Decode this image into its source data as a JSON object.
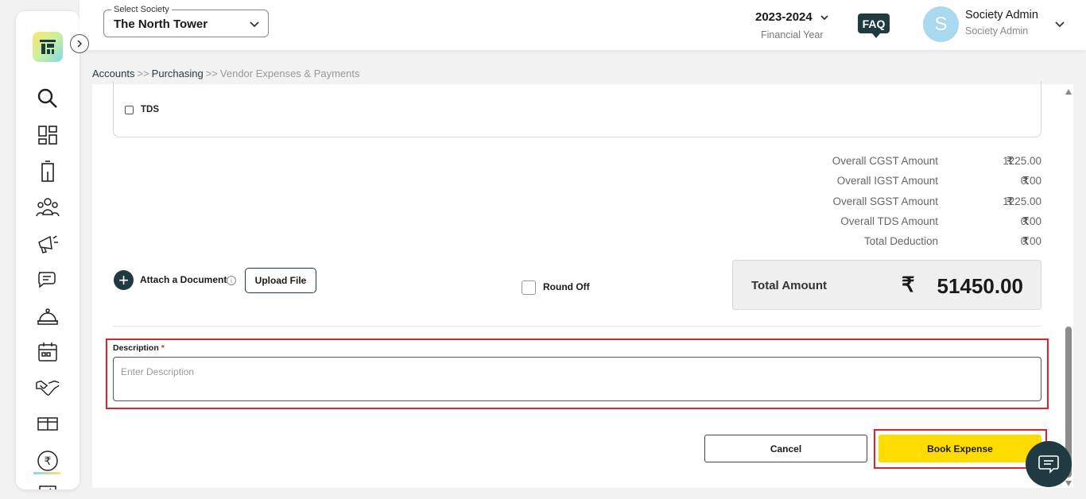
{
  "header": {
    "society_label": "Select Society",
    "society_value": "The North Tower",
    "financial_year": "2023-2024",
    "financial_year_label": "Financial Year",
    "faq_label": "FAQ",
    "avatar_initial": "S",
    "user_name": "Society Admin",
    "user_role": "Society Admin"
  },
  "sidebar": {
    "items": [
      {
        "icon": "search-icon"
      },
      {
        "icon": "dashboard-icon"
      },
      {
        "icon": "building-icon"
      },
      {
        "icon": "members-icon"
      },
      {
        "icon": "announcement-icon"
      },
      {
        "icon": "chat-icon"
      },
      {
        "icon": "service-icon"
      },
      {
        "icon": "calendar-icon"
      },
      {
        "icon": "handshake-icon"
      },
      {
        "icon": "parcel-icon"
      },
      {
        "icon": "rupee-icon"
      },
      {
        "icon": "checklist-icon"
      }
    ]
  },
  "breadcrumb": {
    "accounts": "Accounts",
    "purchasing": "Purchasing",
    "current": "Vendor Expenses & Payments",
    "separator": ">>"
  },
  "form": {
    "tds_label": "TDS",
    "currency_symbol": "₹",
    "summary": [
      {
        "label": "Overall CGST Amount",
        "value": "1225.00"
      },
      {
        "label": "Overall IGST Amount",
        "value": "0.00"
      },
      {
        "label": "Overall SGST Amount",
        "value": "1225.00"
      },
      {
        "label": "Overall TDS Amount",
        "value": "0.00"
      },
      {
        "label": "Total Deduction",
        "value": "0.00"
      }
    ],
    "attach_label": "Attach a Document",
    "info_glyph": "i",
    "upload_label": "Upload File",
    "round_off_label": "Round Off",
    "total_label": "Total Amount",
    "total_value": "51450.00",
    "description_label": "Description",
    "description_required": "*",
    "description_placeholder": "Enter Description",
    "description_value": "",
    "cancel_label": "Cancel",
    "book_label": "Book Expense"
  },
  "colors": {
    "brand_dark": "#1f3a40",
    "primary_yellow": "#ffdc00",
    "highlight_red": "#e0232a"
  }
}
